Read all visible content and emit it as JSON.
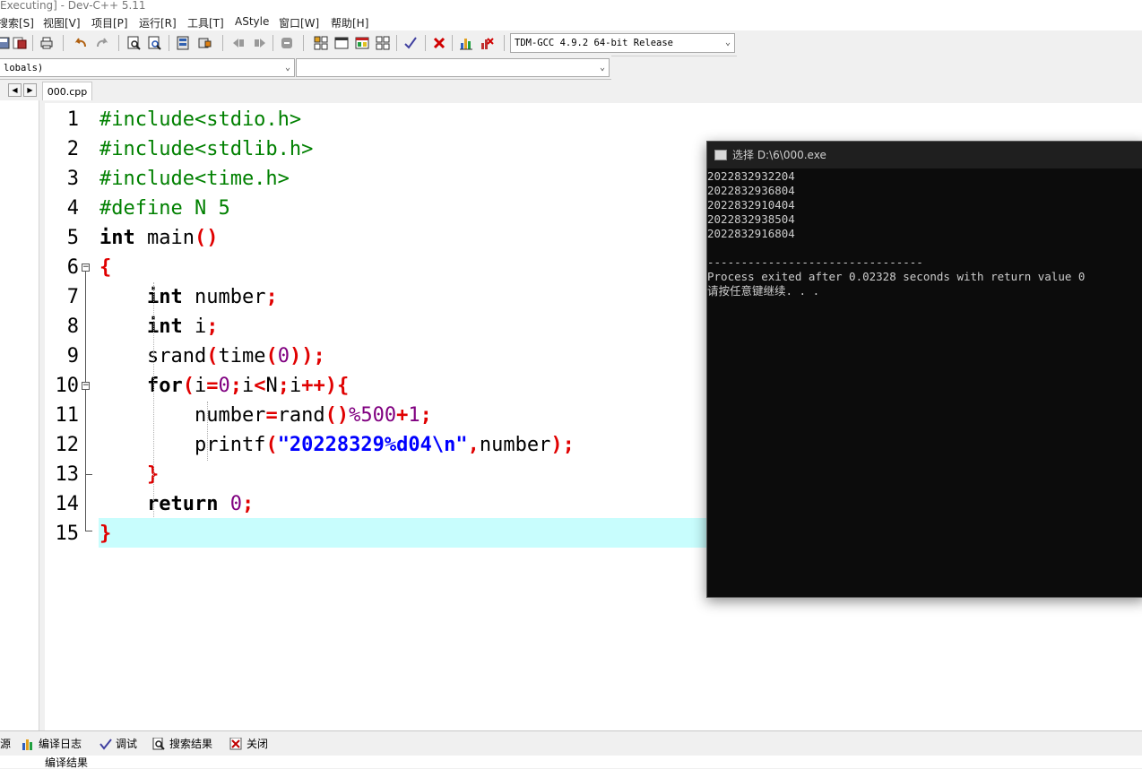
{
  "window": {
    "title": "Executing] - Dev-C++ 5.11"
  },
  "menu": [
    "搜索[S]",
    "视图[V]",
    "项目[P]",
    "运行[R]",
    "工具[T]",
    "AStyle",
    "窗口[W]",
    "帮助[H]"
  ],
  "toolbar": {
    "compiler": "TDM-GCC 4.9.2 64-bit Release"
  },
  "scope": {
    "class_value": "lobals)",
    "member_value": ""
  },
  "editor": {
    "file_tab": "000.cpp",
    "line_numbers": [
      "1",
      "2",
      "3",
      "4",
      "5",
      "6",
      "7",
      "8",
      "9",
      "10",
      "11",
      "12",
      "13",
      "14",
      "15"
    ],
    "current_line": 15,
    "lines": [
      [
        [
          "pp",
          "#include<stdio.h>"
        ]
      ],
      [
        [
          "pp",
          "#include<stdlib.h>"
        ]
      ],
      [
        [
          "pp",
          "#include<time.h>"
        ]
      ],
      [
        [
          "pp",
          "#define N 5"
        ]
      ],
      [
        [
          "kw",
          "int"
        ],
        [
          "id",
          " main"
        ],
        [
          "sym",
          "()"
        ]
      ],
      [
        [
          "sym",
          "{"
        ]
      ],
      [
        [
          "id",
          "    "
        ],
        [
          "kw",
          "int"
        ],
        [
          "id",
          " number"
        ],
        [
          "sym",
          ";"
        ]
      ],
      [
        [
          "id",
          "    "
        ],
        [
          "kw",
          "int"
        ],
        [
          "id",
          " i"
        ],
        [
          "sym",
          ";"
        ]
      ],
      [
        [
          "id",
          "    srand"
        ],
        [
          "sym",
          "("
        ],
        [
          "id",
          "time"
        ],
        [
          "sym",
          "("
        ],
        [
          "num",
          "0"
        ],
        [
          "sym",
          "));"
        ]
      ],
      [
        [
          "id",
          "    "
        ],
        [
          "kw",
          "for"
        ],
        [
          "sym",
          "("
        ],
        [
          "id",
          "i"
        ],
        [
          "sym",
          "="
        ],
        [
          "num",
          "0"
        ],
        [
          "sym",
          ";"
        ],
        [
          "id",
          "i"
        ],
        [
          "sym",
          "<"
        ],
        [
          "id",
          "N"
        ],
        [
          "sym",
          ";"
        ],
        [
          "id",
          "i"
        ],
        [
          "sym",
          "++){"
        ]
      ],
      [
        [
          "id",
          "        number"
        ],
        [
          "sym",
          "="
        ],
        [
          "id",
          "rand"
        ],
        [
          "sym",
          "()"
        ],
        [
          "num",
          "%500"
        ],
        [
          "sym",
          "+"
        ],
        [
          "num",
          "1"
        ],
        [
          "sym",
          ";"
        ]
      ],
      [
        [
          "id",
          "        printf"
        ],
        [
          "sym",
          "("
        ],
        [
          "str",
          "\"20228329%d04\\n\""
        ],
        [
          "sym",
          ","
        ],
        [
          "id",
          "number"
        ],
        [
          "sym",
          ");"
        ]
      ],
      [
        [
          "id",
          "    "
        ],
        [
          "sym",
          "}"
        ]
      ],
      [
        [
          "id",
          "    "
        ],
        [
          "kw",
          "return"
        ],
        [
          "id",
          " "
        ],
        [
          "num",
          "0"
        ],
        [
          "sym",
          ";"
        ]
      ],
      [
        [
          "sym",
          "}"
        ]
      ]
    ]
  },
  "console": {
    "title": "选择 D:\\6\\000.exe",
    "lines": [
      "2022832932204",
      "2022832936804",
      "2022832910404",
      "2022832938504",
      "2022832916804",
      "",
      "--------------------------------",
      "Process exited after 0.02328 seconds with return value 0",
      "请按任意键继续. . ."
    ]
  },
  "bottom_tabs": [
    "源",
    "编译日志",
    "调试",
    "搜索结果",
    "关闭"
  ],
  "bottom_panel": {
    "label": "编译结果"
  }
}
